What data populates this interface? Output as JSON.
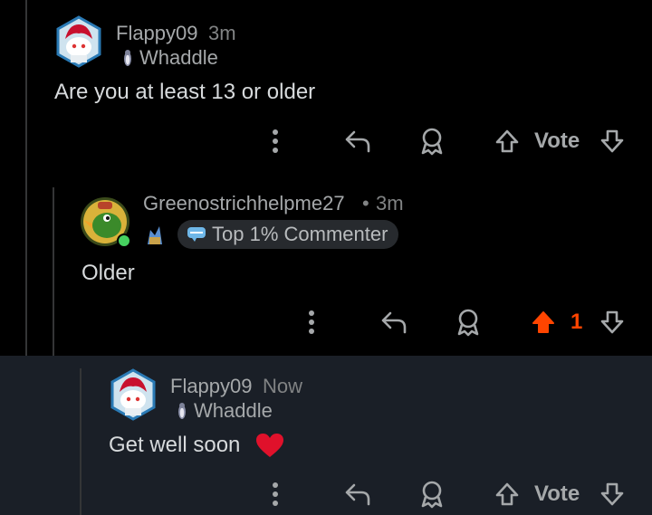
{
  "colors": {
    "upvote_active": "#ff4500",
    "online": "#46d160",
    "highlight_bg": "#1a1f27"
  },
  "comments": [
    {
      "username": "Flappy09",
      "time": "3m",
      "flair": "Whaddle",
      "body": "Are you at least 13 or older",
      "vote_label": "Vote",
      "avatar_icon": "snoo-avatar-icon"
    },
    {
      "username": "Greenostrichhelpme27",
      "separator": "•",
      "time": "3m",
      "badge": "Top 1% Commenter",
      "body": "Older",
      "vote_count": "1",
      "avatar_icon": "duck-avatar-icon"
    },
    {
      "username": "Flappy09",
      "time": "Now",
      "flair": "Whaddle",
      "body": "Get well soon",
      "body_emoji": "red-heart-icon",
      "vote_label": "Vote",
      "avatar_icon": "snoo-avatar-icon"
    }
  ]
}
